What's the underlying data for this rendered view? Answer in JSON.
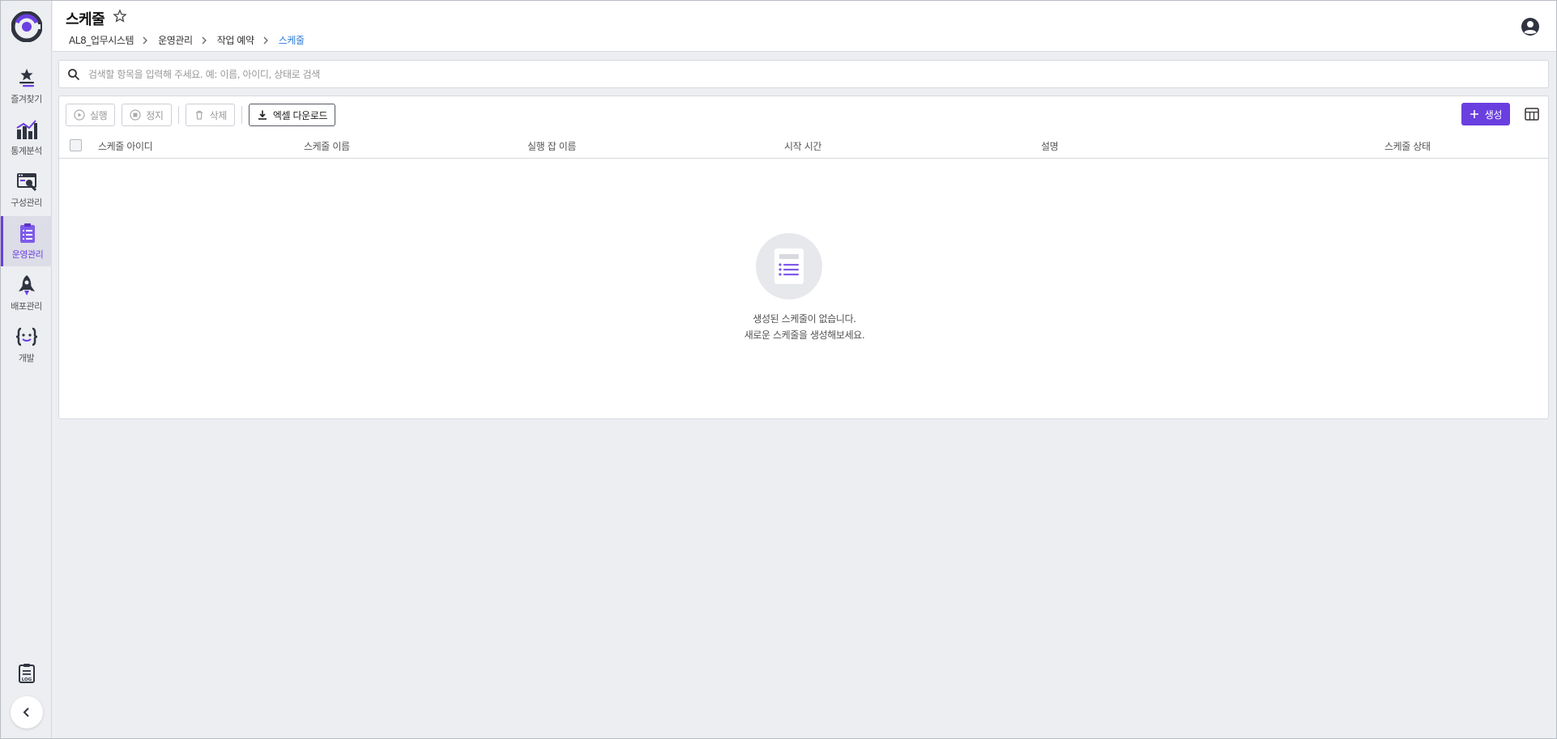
{
  "header": {
    "title": "스케줄",
    "breadcrumb": [
      "AL8_업무시스템",
      "운영관리",
      "작업 예약",
      "스케줄"
    ]
  },
  "sidebar": {
    "items": [
      {
        "label": "즐겨찾기",
        "icon": "star-stack-icon"
      },
      {
        "label": "통계분석",
        "icon": "analytics-icon"
      },
      {
        "label": "구성관리",
        "icon": "config-tools-icon"
      },
      {
        "label": "운영관리",
        "icon": "clipboard-list-icon",
        "active": true
      },
      {
        "label": "배포관리",
        "icon": "rocket-icon"
      },
      {
        "label": "개발",
        "icon": "code-braces-icon"
      }
    ],
    "log_icon": "log-icon",
    "collapse_icon": "chevron-left-icon"
  },
  "search": {
    "placeholder": "검색할 항목을 입력해 주세요. 예: 이름, 아이디, 상태로 검색",
    "value": ""
  },
  "toolbar": {
    "run_label": "실행",
    "stop_label": "정지",
    "delete_label": "삭제",
    "excel_label": "엑셀 다운로드",
    "create_label": "생성"
  },
  "table": {
    "columns": [
      "스케줄 아이디",
      "스케줄 이름",
      "실행 잡 이름",
      "시작 시간",
      "설명",
      "스케줄 상태"
    ],
    "rows": []
  },
  "empty": {
    "line1": "생성된 스케줄이 없습니다.",
    "line2": "새로운 스케줄을 생성해보세요."
  },
  "colors": {
    "accent": "#6a3fe0",
    "breadcrumb_current": "#2b7bd6",
    "background": "#eceef1"
  }
}
